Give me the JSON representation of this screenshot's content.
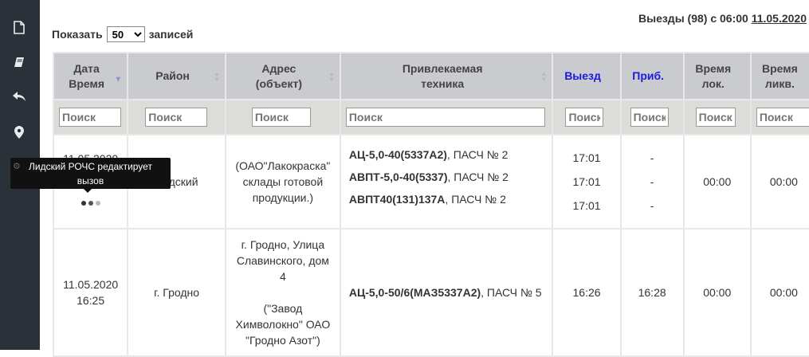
{
  "summary": {
    "text": "Выезды (98) с 06:00",
    "date": "11.05.2020"
  },
  "length": {
    "prefix": "Показать",
    "value": "50",
    "suffix": "записей"
  },
  "columns": [
    {
      "label_line1": "Дата",
      "label_line2": "Время",
      "sort": "desc"
    },
    {
      "label_line1": "Район",
      "label_line2": "",
      "sort": "both"
    },
    {
      "label_line1": "Адрес",
      "label_line2": "(объект)",
      "sort": "both"
    },
    {
      "label_line1": "Привлекаемая",
      "label_line2": "техника",
      "sort": "both"
    },
    {
      "label_line1": "Выезд",
      "label_line2": "",
      "sort": "none"
    },
    {
      "label_line1": "Приб.",
      "label_line2": "",
      "sort": "none"
    },
    {
      "label_line1": "Время",
      "label_line2": "лок.",
      "sort": "none"
    },
    {
      "label_line1": "Время",
      "label_line2": "ликв.",
      "sort": "none"
    }
  ],
  "filter_placeholder": "Поиск",
  "rows": [
    {
      "date": "11.05.2020",
      "time": "",
      "district": "Лидский",
      "address_lines": [
        "(ОАО\"Лакокраска\"",
        "склады готовой",
        "продукции.)"
      ],
      "tech": [
        {
          "unit": "АЦ-5,0-40(5337А2)",
          "station": ", ПАСЧ № 2"
        },
        {
          "unit": "АВПТ-5,0-40(5337)",
          "station": ", ПАСЧ № 2"
        },
        {
          "unit": "АВПТ40(131)137А",
          "station": ", ПАСЧ № 2"
        }
      ],
      "departure": [
        "17:01",
        "17:01",
        "17:01"
      ],
      "arrival": [
        "-",
        "-",
        "-"
      ],
      "loc_time": "00:00",
      "liq_time": "00:00"
    },
    {
      "date": "11.05.2020",
      "time": "16:25",
      "district": "г. Гродно",
      "address_lines": [
        "г. Гродно, Улица",
        "Славинского, дом",
        "4",
        "",
        "(\"Завод",
        "Химволокно\" ОАО",
        "\"Гродно Азот\")"
      ],
      "tech": [
        {
          "unit": "АЦ-5,0-50/6(МАЗ5337А2)",
          "station": ", ПАСЧ № 5"
        }
      ],
      "departure": [
        "16:26"
      ],
      "arrival": [
        "16:28"
      ],
      "loc_time": "00:00",
      "liq_time": "00:00"
    }
  ],
  "tooltip": {
    "line1": "Лидский РОЧС редактирует",
    "line2": "вызов"
  },
  "sidebar": {
    "icons": [
      "document-icon",
      "book-icon",
      "reply-icon",
      "map-marker-icon"
    ]
  }
}
